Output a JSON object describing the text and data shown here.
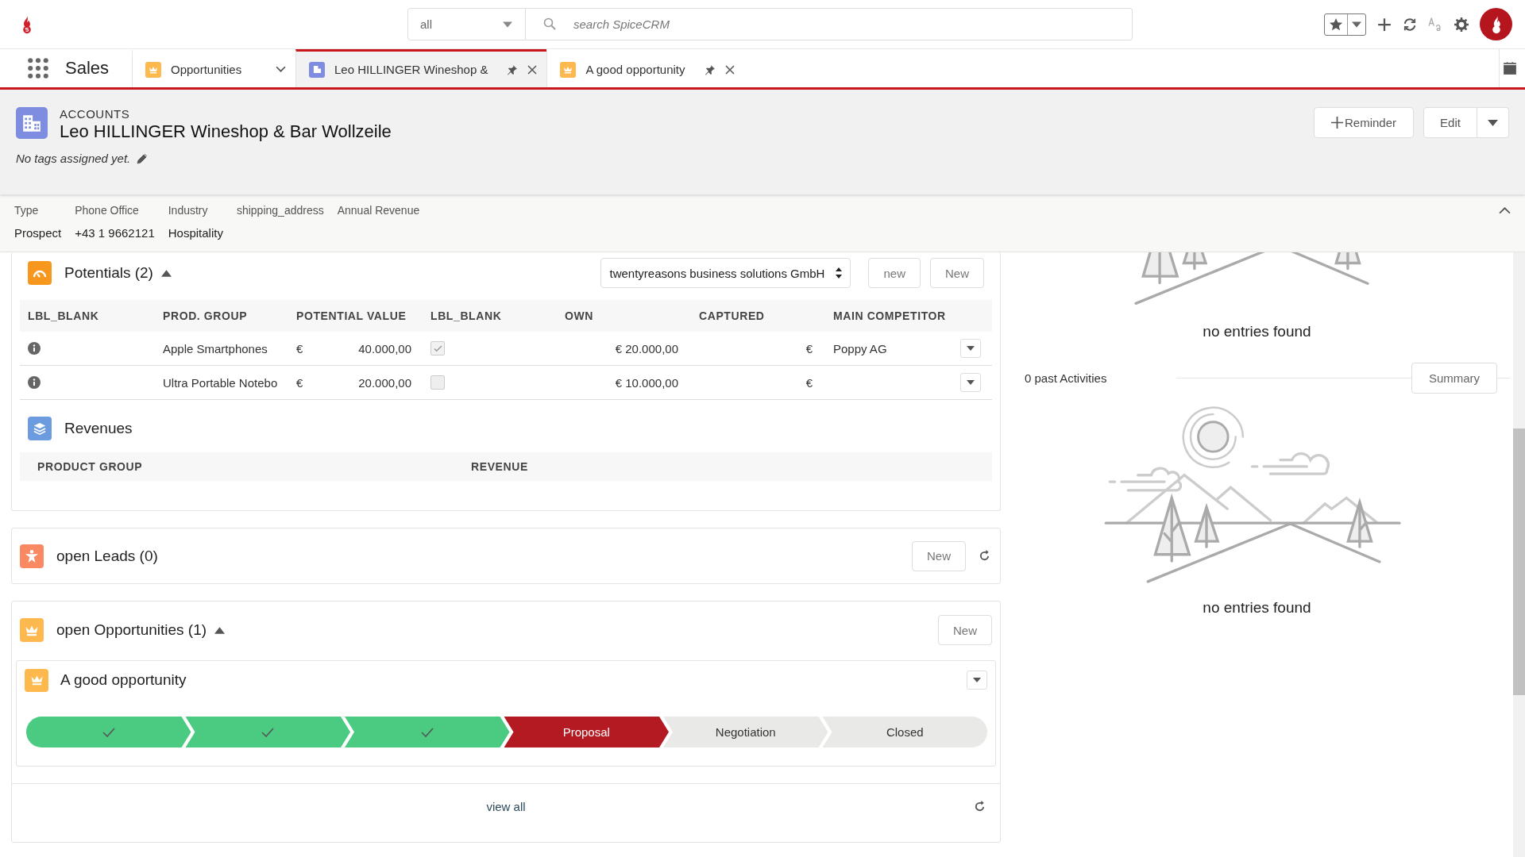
{
  "top_bar": {
    "scope": "all",
    "search": {
      "placeholder": "search SpiceCRM"
    }
  },
  "nav": {
    "app": "Sales",
    "tabs": [
      {
        "label": "Opportunities",
        "kind": "module",
        "selected": false
      },
      {
        "label": "Leo HILLINGER Wineshop &",
        "kind": "account",
        "selected": true
      },
      {
        "label": "A good opportunity",
        "kind": "opportunity",
        "selected": false
      }
    ]
  },
  "header": {
    "module": "ACCOUNTS",
    "title": "Leo HILLINGER Wineshop & Bar Wollzeile",
    "tags": "No tags assigned yet.",
    "reminder_button": "Reminder",
    "edit_button": "Edit"
  },
  "fields": [
    {
      "label": "Type",
      "value": "Prospect"
    },
    {
      "label": "Phone Office",
      "value": "+43 1 9662121"
    },
    {
      "label": "Industry",
      "value": "Hospitality"
    },
    {
      "label": "shipping_address"
    },
    {
      "label": "Annual Revenue"
    }
  ],
  "potentials": {
    "title": "Potentials (2)",
    "expanded": true,
    "company": "twentyreasons business solutions GmbH",
    "buttons": [
      "new",
      "New"
    ],
    "columns": [
      "LBL_BLANK",
      "PROD. GROUP",
      "POTENTIAL VALUE",
      "LBL_BLANK",
      "OWN",
      "CAPTURED",
      "MAIN COMPETITOR"
    ],
    "rows": [
      {
        "prod_group": "Apple Smartphones",
        "currency": "€",
        "potential_value": "40.000,00",
        "checked": true,
        "own": "€ 20.000,00",
        "captured": "€",
        "main_competitor": "Poppy AG"
      },
      {
        "prod_group": "Ultra Portable Notebo",
        "currency": "€",
        "potential_value": "20.000,00",
        "checked": false,
        "own": "€ 10.000,00",
        "captured": "€"
      }
    ]
  },
  "revenues": {
    "title": "Revenues",
    "columns": [
      "PRODUCT GROUP",
      "REVENUE"
    ]
  },
  "leads": {
    "title": "open Leads (0)",
    "button": "New"
  },
  "opportunities": {
    "title": "open Opportunities (1)",
    "expanded": true,
    "button": "New",
    "items": [
      {
        "name": "A good opportunity",
        "stages": [
          {
            "completed": true,
            "selected": false
          },
          {
            "completed": true,
            "selected": false
          },
          {
            "completed": true,
            "selected": false
          },
          {
            "label": "Proposal",
            "completed": false,
            "selected": true
          },
          {
            "label": "Negotiation",
            "completed": false,
            "selected": false
          },
          {
            "label": "Closed",
            "completed": false,
            "selected": false
          }
        ]
      }
    ],
    "footer": "view all"
  },
  "activities": {
    "upcoming_empty": "no entries found",
    "past_label": "0 past Activities",
    "summary_button": "Summary",
    "past_empty": "no entries found"
  }
}
